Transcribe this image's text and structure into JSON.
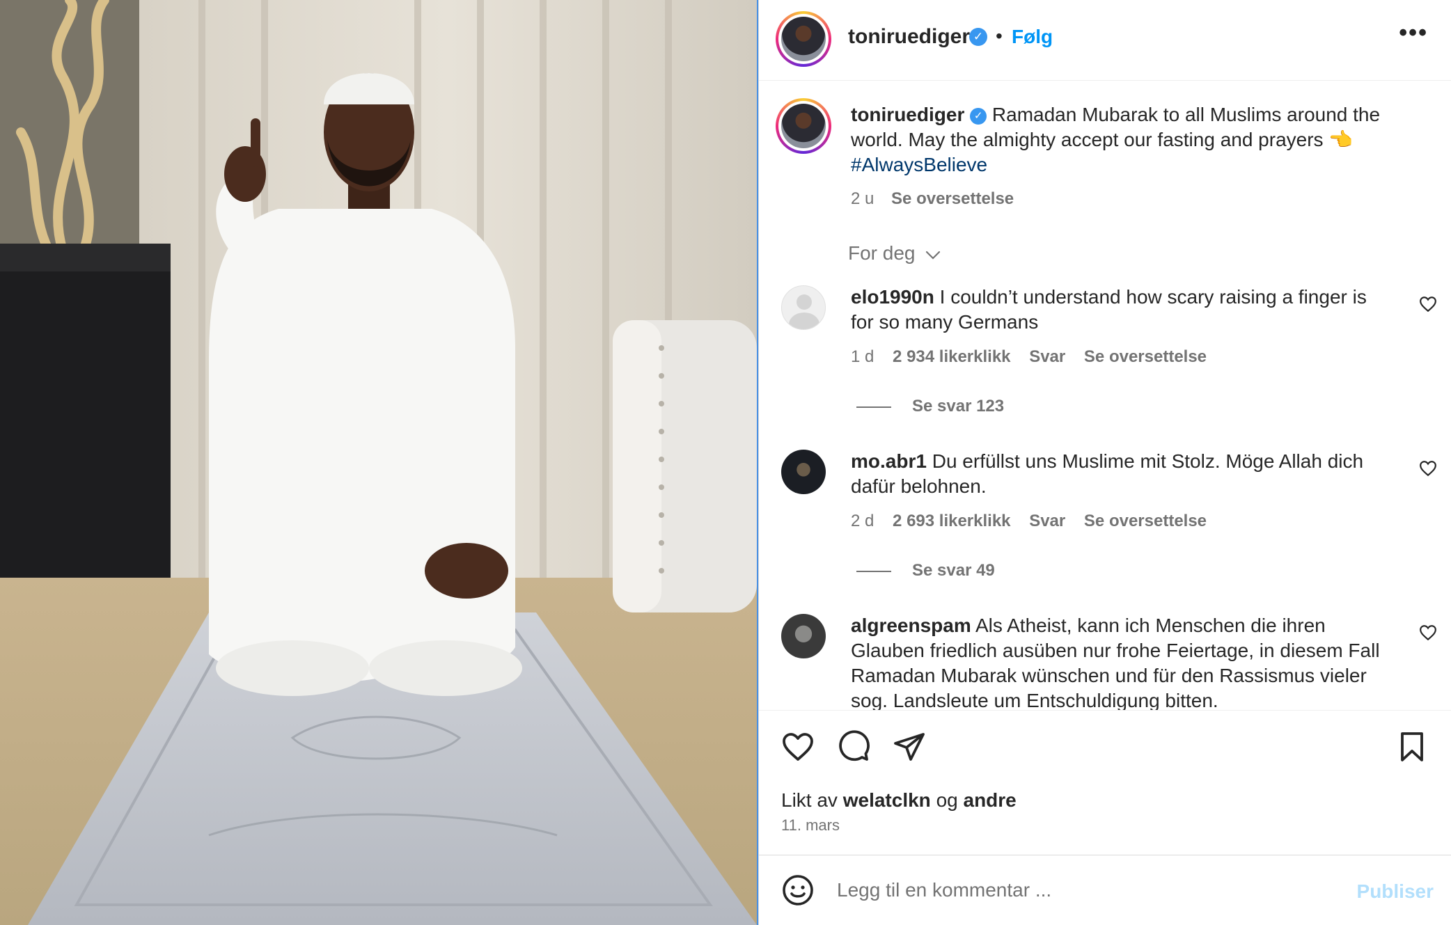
{
  "post": {
    "image_alt": "Man in white thobe and kufi kneeling on a prayer rug, raising index finger",
    "author": "toniruediger",
    "verified": true,
    "follow_label": "Følg",
    "dot": "•",
    "more_label": "•••"
  },
  "caption": {
    "username": "toniruediger",
    "line1": "Ramadan Mubarak to all Muslims around the",
    "line2": "world. May the almighty accept our fasting and prayers 👈",
    "hashtag": "#AlwaysBelieve",
    "time": "2 u",
    "translate": "Se oversettelse"
  },
  "filter": {
    "label": "For deg"
  },
  "comments": [
    {
      "username": "elo1990n",
      "line1": "I couldn’t understand how scary raising a finger is",
      "line2": "for so many Germans",
      "time": "1 d",
      "likes": "2 934 likerklikk",
      "reply": "Svar",
      "translate": "Se oversettelse",
      "replies": "Se svar 123"
    },
    {
      "username": "mo.abr1",
      "line1": "Du erfüllst uns Muslime mit Stolz. Möge Allah dich",
      "line2": "dafür belohnen.",
      "time": "2 d",
      "likes": "2 693 likerklikk",
      "reply": "Svar",
      "translate": "Se oversettelse",
      "replies": "Se svar 49"
    },
    {
      "username": "algreenspam",
      "line1": "Als Atheist, kann ich Menschen die ihren",
      "line2": "Glauben friedlich ausüben nur frohe Feiertage, in diesem Fall",
      "line3": "Ramadan Mubarak wünschen und für den Rassismus vieler",
      "line4": "sog. Landsleute um Entschuldigung bitten."
    }
  ],
  "likes": {
    "prefix": "Likt av",
    "user": "welatclkn",
    "joiner": "og",
    "others": "andre"
  },
  "date": "11. mars",
  "composer": {
    "placeholder": "Legg til en kommentar ...",
    "publish": "Publiser"
  },
  "icons": {
    "like": "heart-icon",
    "comment": "comment-icon",
    "share": "send-icon",
    "save": "bookmark-icon",
    "emoji": "emoji-icon",
    "more": "more-icon",
    "verified": "verified-badge-icon"
  },
  "colors": {
    "link": "#0095f6",
    "hashtag": "#00376b",
    "verified": "#3897f0",
    "muted": "#737373"
  }
}
